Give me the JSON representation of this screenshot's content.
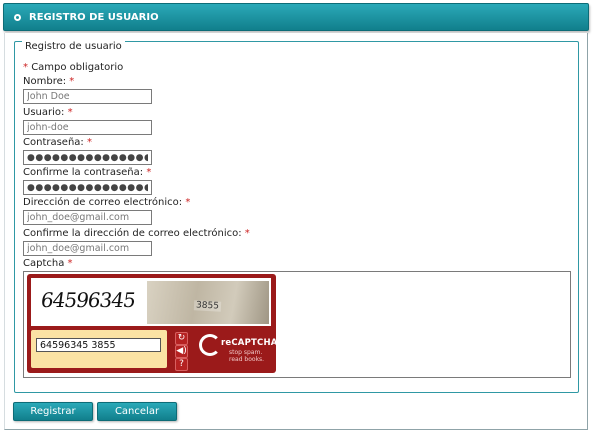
{
  "header": {
    "title": "REGISTRO DE USUARIO"
  },
  "form": {
    "legend": "Registro de usuario",
    "required_note": "Campo obligatorio",
    "required_mark": "*",
    "fields": {
      "nombre": {
        "label": "Nombre:",
        "value": "John Doe"
      },
      "usuario": {
        "label": "Usuario:",
        "value": "john-doe"
      },
      "password": {
        "label": "Contraseña:",
        "value": "●●●●●●●●●●●●●●●●"
      },
      "password_confirm": {
        "label": "Confirme la contraseña:",
        "value": "●●●●●●●●●●●●●●●●"
      },
      "email": {
        "label": "Dirección de correo electrónico:",
        "value": "john_doe@gmail.com"
      },
      "email_confirm": {
        "label": "Confirme la dirección de correo electrónico:",
        "value": "john_doe@gmail.com"
      },
      "captcha": {
        "label": "Captcha"
      }
    }
  },
  "captcha": {
    "word_image_text": "64596345",
    "photo_number_text": "3855",
    "answer_value": "64596345 3855",
    "logo_text": "reCAPTCHA",
    "logo_tm": "™",
    "tagline_1": "stop spam.",
    "tagline_2": "read books.",
    "reload_icon": "↻",
    "audio_icon": "◀)",
    "help_icon": "?"
  },
  "buttons": {
    "submit": "Registrar",
    "cancel": "Cancelar"
  },
  "colors": {
    "accent": "#1f97a5",
    "required": "#cc2222",
    "recaptcha_red": "#9b1a1a",
    "answer_zone": "#fbe3a4"
  }
}
